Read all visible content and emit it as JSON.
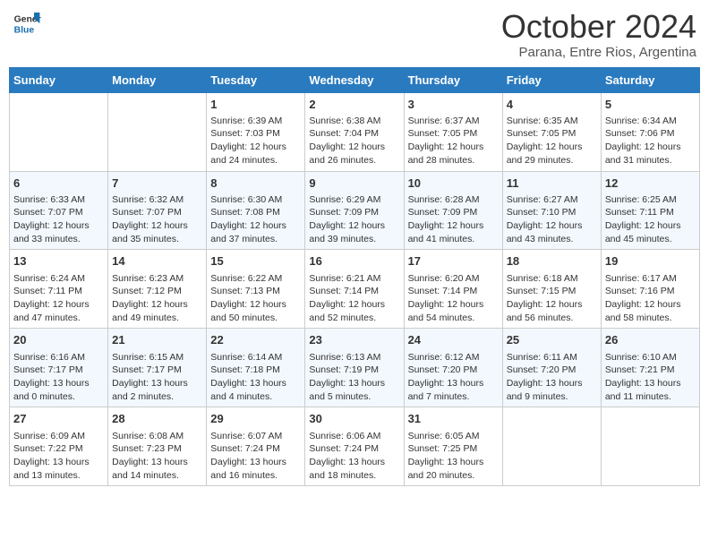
{
  "logo": {
    "line1": "General",
    "line2": "Blue"
  },
  "title": "October 2024",
  "subtitle": "Parana, Entre Rios, Argentina",
  "weekdays": [
    "Sunday",
    "Monday",
    "Tuesday",
    "Wednesday",
    "Thursday",
    "Friday",
    "Saturday"
  ],
  "weeks": [
    [
      {
        "day": "",
        "info": ""
      },
      {
        "day": "",
        "info": ""
      },
      {
        "day": "1",
        "info": "Sunrise: 6:39 AM\nSunset: 7:03 PM\nDaylight: 12 hours and 24 minutes."
      },
      {
        "day": "2",
        "info": "Sunrise: 6:38 AM\nSunset: 7:04 PM\nDaylight: 12 hours and 26 minutes."
      },
      {
        "day": "3",
        "info": "Sunrise: 6:37 AM\nSunset: 7:05 PM\nDaylight: 12 hours and 28 minutes."
      },
      {
        "day": "4",
        "info": "Sunrise: 6:35 AM\nSunset: 7:05 PM\nDaylight: 12 hours and 29 minutes."
      },
      {
        "day": "5",
        "info": "Sunrise: 6:34 AM\nSunset: 7:06 PM\nDaylight: 12 hours and 31 minutes."
      }
    ],
    [
      {
        "day": "6",
        "info": "Sunrise: 6:33 AM\nSunset: 7:07 PM\nDaylight: 12 hours and 33 minutes."
      },
      {
        "day": "7",
        "info": "Sunrise: 6:32 AM\nSunset: 7:07 PM\nDaylight: 12 hours and 35 minutes."
      },
      {
        "day": "8",
        "info": "Sunrise: 6:30 AM\nSunset: 7:08 PM\nDaylight: 12 hours and 37 minutes."
      },
      {
        "day": "9",
        "info": "Sunrise: 6:29 AM\nSunset: 7:09 PM\nDaylight: 12 hours and 39 minutes."
      },
      {
        "day": "10",
        "info": "Sunrise: 6:28 AM\nSunset: 7:09 PM\nDaylight: 12 hours and 41 minutes."
      },
      {
        "day": "11",
        "info": "Sunrise: 6:27 AM\nSunset: 7:10 PM\nDaylight: 12 hours and 43 minutes."
      },
      {
        "day": "12",
        "info": "Sunrise: 6:25 AM\nSunset: 7:11 PM\nDaylight: 12 hours and 45 minutes."
      }
    ],
    [
      {
        "day": "13",
        "info": "Sunrise: 6:24 AM\nSunset: 7:11 PM\nDaylight: 12 hours and 47 minutes."
      },
      {
        "day": "14",
        "info": "Sunrise: 6:23 AM\nSunset: 7:12 PM\nDaylight: 12 hours and 49 minutes."
      },
      {
        "day": "15",
        "info": "Sunrise: 6:22 AM\nSunset: 7:13 PM\nDaylight: 12 hours and 50 minutes."
      },
      {
        "day": "16",
        "info": "Sunrise: 6:21 AM\nSunset: 7:14 PM\nDaylight: 12 hours and 52 minutes."
      },
      {
        "day": "17",
        "info": "Sunrise: 6:20 AM\nSunset: 7:14 PM\nDaylight: 12 hours and 54 minutes."
      },
      {
        "day": "18",
        "info": "Sunrise: 6:18 AM\nSunset: 7:15 PM\nDaylight: 12 hours and 56 minutes."
      },
      {
        "day": "19",
        "info": "Sunrise: 6:17 AM\nSunset: 7:16 PM\nDaylight: 12 hours and 58 minutes."
      }
    ],
    [
      {
        "day": "20",
        "info": "Sunrise: 6:16 AM\nSunset: 7:17 PM\nDaylight: 13 hours and 0 minutes."
      },
      {
        "day": "21",
        "info": "Sunrise: 6:15 AM\nSunset: 7:17 PM\nDaylight: 13 hours and 2 minutes."
      },
      {
        "day": "22",
        "info": "Sunrise: 6:14 AM\nSunset: 7:18 PM\nDaylight: 13 hours and 4 minutes."
      },
      {
        "day": "23",
        "info": "Sunrise: 6:13 AM\nSunset: 7:19 PM\nDaylight: 13 hours and 5 minutes."
      },
      {
        "day": "24",
        "info": "Sunrise: 6:12 AM\nSunset: 7:20 PM\nDaylight: 13 hours and 7 minutes."
      },
      {
        "day": "25",
        "info": "Sunrise: 6:11 AM\nSunset: 7:20 PM\nDaylight: 13 hours and 9 minutes."
      },
      {
        "day": "26",
        "info": "Sunrise: 6:10 AM\nSunset: 7:21 PM\nDaylight: 13 hours and 11 minutes."
      }
    ],
    [
      {
        "day": "27",
        "info": "Sunrise: 6:09 AM\nSunset: 7:22 PM\nDaylight: 13 hours and 13 minutes."
      },
      {
        "day": "28",
        "info": "Sunrise: 6:08 AM\nSunset: 7:23 PM\nDaylight: 13 hours and 14 minutes."
      },
      {
        "day": "29",
        "info": "Sunrise: 6:07 AM\nSunset: 7:24 PM\nDaylight: 13 hours and 16 minutes."
      },
      {
        "day": "30",
        "info": "Sunrise: 6:06 AM\nSunset: 7:24 PM\nDaylight: 13 hours and 18 minutes."
      },
      {
        "day": "31",
        "info": "Sunrise: 6:05 AM\nSunset: 7:25 PM\nDaylight: 13 hours and 20 minutes."
      },
      {
        "day": "",
        "info": ""
      },
      {
        "day": "",
        "info": ""
      }
    ]
  ]
}
